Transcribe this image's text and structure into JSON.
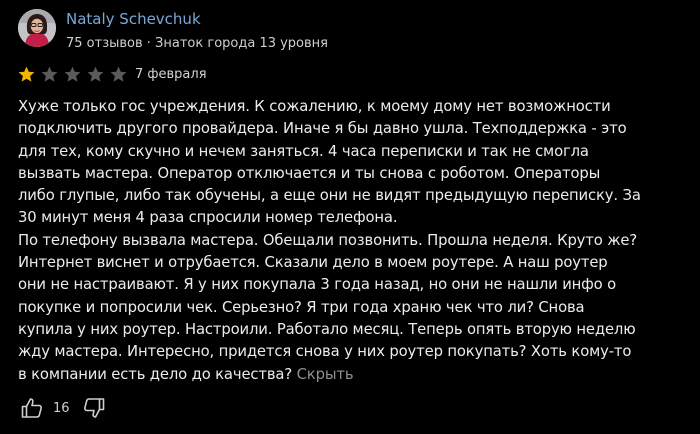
{
  "author": {
    "name": "Nataly Schevchuk",
    "meta": "75 отзывов · Знаток города 13 уровня"
  },
  "review": {
    "rating": 1,
    "max_rating": 5,
    "date": "7 февраля",
    "text": "Хуже только гос учреждения. К сожалению, к моему дому нет возможности\nподключить другого провайдера. Иначе я бы давно ушла. Техподдержка - это\nдля тех, кому скучно и нечем заняться. 4 часа переписки и так не смогла\nвызвать мастера. Оператор отключается и ты снова с роботом. Операторы\nлибо глупые, либо так обучены, а еще они не видят предыдущую переписку. За\n30 минут меня 4 раза спросили номер телефона.\nПо телефону вызвала мастера. Обещали позвонить. Прошла неделя. Круто же?\nИнтернет виснет и отрубается. Сказали дело в моем роутере. А наш роутер\nони не настраивают. Я у них покупала 3 года назад, но они не нашли инфо о\nпокупке и попросили чек. Серьезно? Я три года храню чек что ли? Снова\nкупила у них роутер. Настроили. Работало месяц. Теперь опять вторую неделю\nжду мастера. Интересно, придется снова у них роутер покупать? Хоть кому-то\nв компании есть дело до качества?",
    "collapse_label": "Скрыть"
  },
  "reactions": {
    "likes": "16",
    "like_icon": "thumbs-up-icon",
    "dislike_icon": "thumbs-down-icon"
  },
  "colors": {
    "background": "#000000",
    "author_name": "#79a8d8",
    "star_filled": "#f5b400",
    "star_empty": "#5a5a5a",
    "collapse_link": "#8f8f8f"
  }
}
